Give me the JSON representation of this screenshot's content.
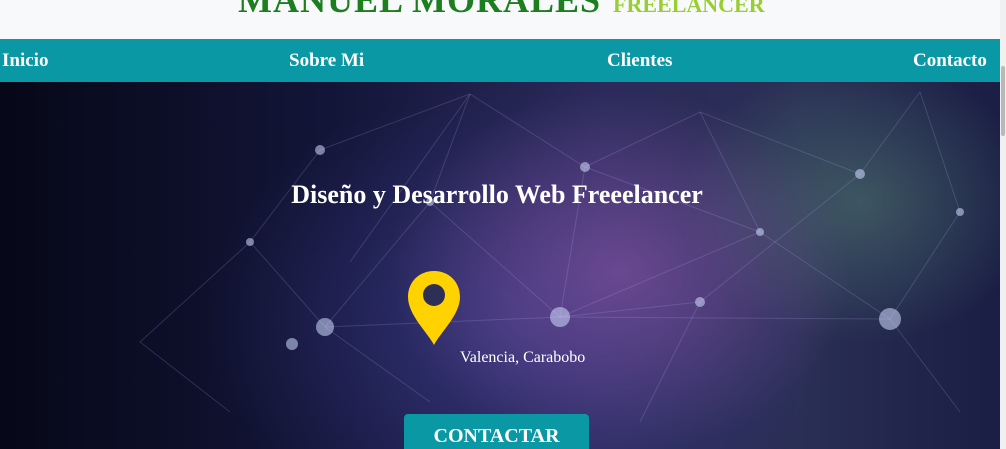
{
  "header": {
    "name": "MANUEL MORALES",
    "tagline": "FREELANCER"
  },
  "nav": {
    "items": [
      {
        "label": "Inicio"
      },
      {
        "label": "Sobre Mi"
      },
      {
        "label": "Clientes"
      },
      {
        "label": "Contacto"
      }
    ]
  },
  "hero": {
    "title": "Diseño y Desarrollo Web Freeelancer",
    "location": "Valencia, Carabobo",
    "cta_label": "CONTACTAR",
    "pin_icon": "map-pin-icon",
    "pin_color": "#ffd200"
  },
  "colors": {
    "nav_bg": "#0a99a4",
    "brand_name": "#1e7d1e",
    "brand_tag": "#9acd32"
  }
}
